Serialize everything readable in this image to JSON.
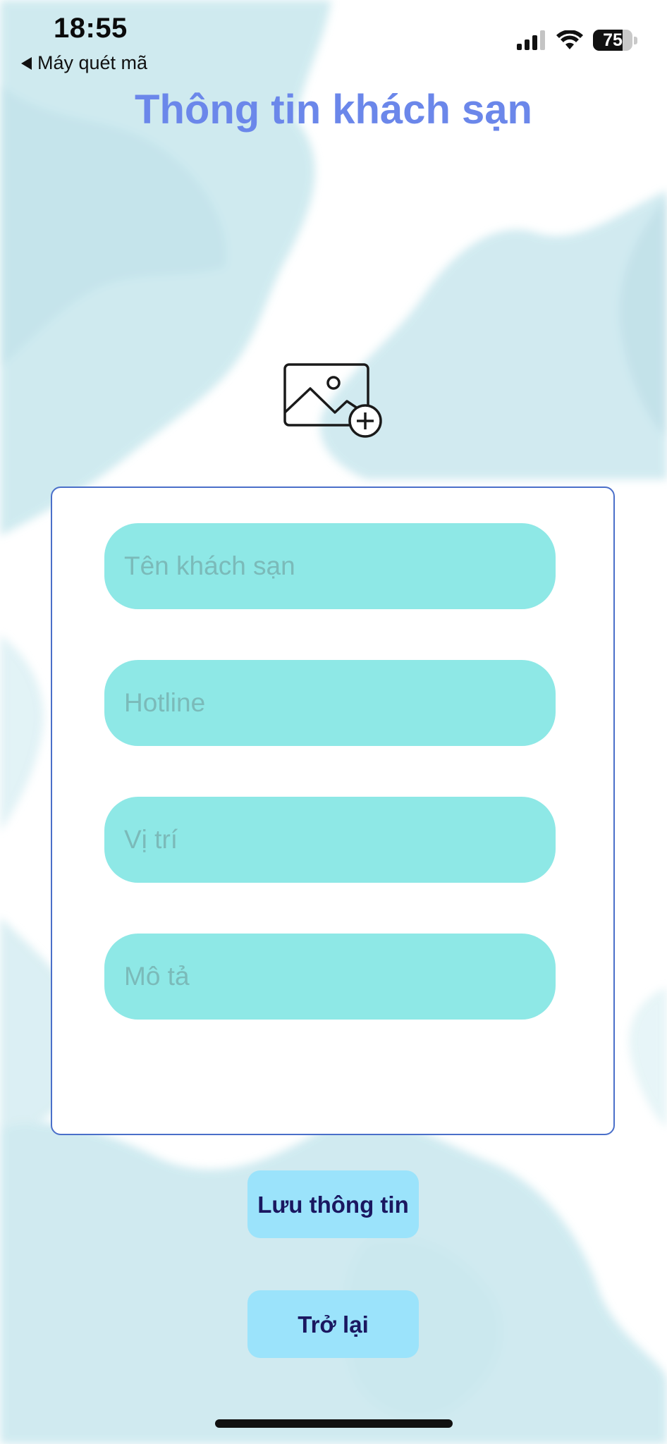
{
  "status_bar": {
    "time": "18:55",
    "back_label": "Máy quét mã",
    "battery_level": "75",
    "battery_fraction": 0.75
  },
  "header": {
    "title": "Thông tin khách sạn"
  },
  "image_picker": {
    "icon": "add-image-icon"
  },
  "form": {
    "fields": [
      {
        "placeholder": "Tên khách sạn",
        "value": ""
      },
      {
        "placeholder": "Hotline",
        "value": ""
      },
      {
        "placeholder": "Vị trí",
        "value": ""
      },
      {
        "placeholder": "Mô tả",
        "value": ""
      }
    ]
  },
  "actions": {
    "save_label": "Lưu thông tin",
    "back_label": "Trở lại"
  },
  "colors": {
    "title": "#6b87ea",
    "field_bg": "#8ee8e6",
    "button_bg": "#9be3fb",
    "button_text": "#1a1760",
    "card_border": "#4a6fc9",
    "watercolor": "#c5e6ec"
  }
}
